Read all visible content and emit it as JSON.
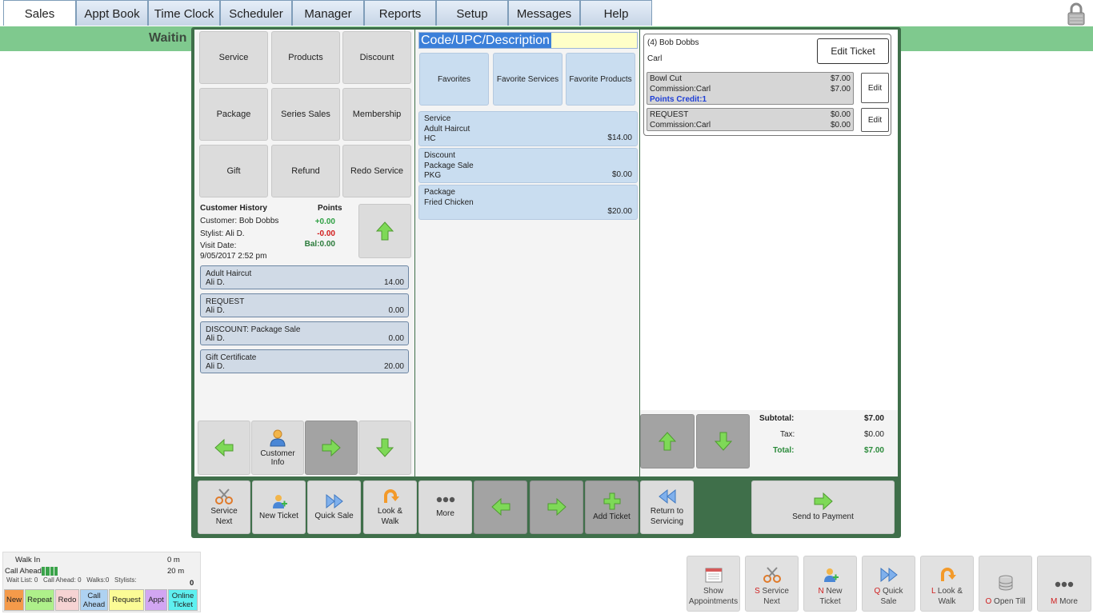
{
  "tabs": [
    "Sales",
    "Appt Book",
    "Time Clock",
    "Scheduler",
    "Manager",
    "Reports",
    "Setup",
    "Messages",
    "Help"
  ],
  "waiting_label": "Waitin",
  "categories": [
    "Service",
    "Products",
    "Discount",
    "Package",
    "Series Sales",
    "Membership",
    "Gift",
    "Refund",
    "Redo Service"
  ],
  "customer_history": {
    "title": "Customer History",
    "points_label": "Points",
    "customer": "Customer: Bob Dobbs",
    "stylist": "Stylist: Ali D.",
    "visit_date_label": "Visit Date:",
    "visit_date": "9/05/2017 2:52 pm",
    "points_plus": "+0.00",
    "points_minus": "-0.00",
    "balance": "Bal:0.00",
    "items": [
      {
        "name": "Adult Haircut",
        "stylist": "Ali D.",
        "amount": "14.00"
      },
      {
        "name": "REQUEST",
        "stylist": "Ali D.",
        "amount": "0.00"
      },
      {
        "name": "DISCOUNT: Package Sale",
        "stylist": "Ali D.",
        "amount": "0.00"
      },
      {
        "name": "Gift Certificate",
        "stylist": "Ali D.",
        "amount": "20.00"
      }
    ]
  },
  "customer_info_label": "Customer Info",
  "search": {
    "value": "Code/UPC/Description"
  },
  "favorites": [
    "Favorites",
    "Favorite Services",
    "Favorite Products"
  ],
  "items": [
    {
      "type": "Service",
      "name": "Adult Haircut",
      "code": "HC",
      "price": "$14.00"
    },
    {
      "type": "Discount",
      "name": "Package Sale",
      "code": "PKG",
      "price": "$0.00"
    },
    {
      "type": "Package",
      "name": "Fried Chicken",
      "code": "",
      "price": "$20.00"
    }
  ],
  "ticket": {
    "number_name": "(4) Bob Dobbs",
    "stylist": "Carl",
    "edit_ticket_label": "Edit Ticket",
    "lines": [
      {
        "name": "Bowl Cut",
        "commission": "Commission:Carl",
        "price": "$7.00",
        "commission_amount": "$7.00",
        "points": "Points Credit:1",
        "edit": "Edit"
      },
      {
        "name": "REQUEST",
        "commission": "Commission:Carl",
        "price": "$0.00",
        "commission_amount": "$0.00",
        "points": "",
        "edit": "Edit"
      }
    ],
    "subtotal_label": "Subtotal:",
    "subtotal": "$7.00",
    "tax_label": "Tax:",
    "tax": "$0.00",
    "total_label": "Total:",
    "total": "$7.00"
  },
  "actions": {
    "service_next": "Service Next",
    "new_ticket": "New Ticket",
    "quick_sale": "Quick Sale",
    "look_walk": "Look & Walk",
    "more": "More",
    "add_ticket": "Add Ticket",
    "return_servicing": "Return to Servicing",
    "send_payment": "Send to Payment"
  },
  "wait_panel": {
    "walk_in": "Walk In",
    "walk_in_time": "0 m",
    "call_ahead": "Call Ahead",
    "call_ahead_time": "20 m",
    "stats": "Wait List: 0   Call Ahead: 0   Walks:0   Stylists:",
    "stylists_count": "0",
    "legend": [
      {
        "label": "New",
        "color": "#f49a4a"
      },
      {
        "label": "Repeat",
        "color": "#aef08a"
      },
      {
        "label": "Redo",
        "color": "#f6d3d3"
      },
      {
        "label": "Call Ahead",
        "color": "#aed2f2"
      },
      {
        "label": "Request",
        "color": "#fbfb96"
      },
      {
        "label": "Appt",
        "color": "#d2a6f2"
      },
      {
        "label": "Online Ticket",
        "color": "#5ef0f0"
      }
    ]
  },
  "quick_bar": [
    {
      "key": "",
      "label": "Show Appointments"
    },
    {
      "key": "S",
      "label": "Service Next"
    },
    {
      "key": "N",
      "label": "New Ticket"
    },
    {
      "key": "Q",
      "label": "Quick Sale"
    },
    {
      "key": "L",
      "label": "Look & Walk"
    },
    {
      "key": "O",
      "label": "Open Till"
    },
    {
      "key": "M",
      "label": "More"
    }
  ]
}
